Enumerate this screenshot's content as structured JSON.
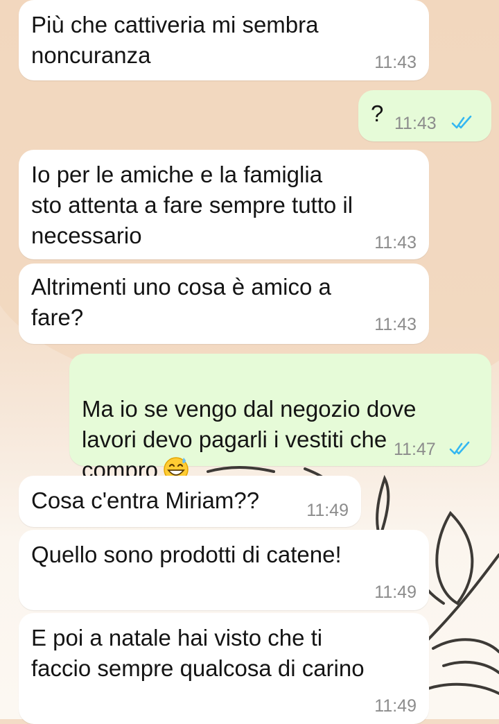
{
  "colors": {
    "incoming_bubble": "#ffffff",
    "outgoing_bubble": "#e6fbd8",
    "read_ticks": "#34b7f1",
    "timestamp": "#8c8c8c"
  },
  "messages": [
    {
      "direction": "incoming",
      "text": "Più che cattiveria mi sembra\nnoncuranza",
      "time": "11:43"
    },
    {
      "direction": "outgoing",
      "text": "?",
      "time": "11:43",
      "status_icon": "double-check-read-icon"
    },
    {
      "direction": "incoming",
      "text": "Io per le amiche e la famiglia\nsto attenta a fare sempre tutto il\nnecessario",
      "time": "11:43"
    },
    {
      "direction": "incoming",
      "text": "Altrimenti uno cosa è amico a\nfare?",
      "time": "11:43"
    },
    {
      "direction": "outgoing",
      "text": "Ma io se vengo dal negozio dove\nlavori devo pagarli i vestiti che\ncompro",
      "emoji": "grinning-face-with-sweat-emoji",
      "time": "11:47",
      "status_icon": "double-check-read-icon"
    },
    {
      "direction": "incoming",
      "text": "Cosa c'entra Miriam??",
      "time": "11:49"
    },
    {
      "direction": "incoming",
      "text": "Quello sono prodotti di catene!",
      "time": "11:49"
    },
    {
      "direction": "incoming",
      "text": "E poi a natale hai visto che ti\nfaccio sempre qualcosa di carino",
      "time": "11:49"
    }
  ]
}
